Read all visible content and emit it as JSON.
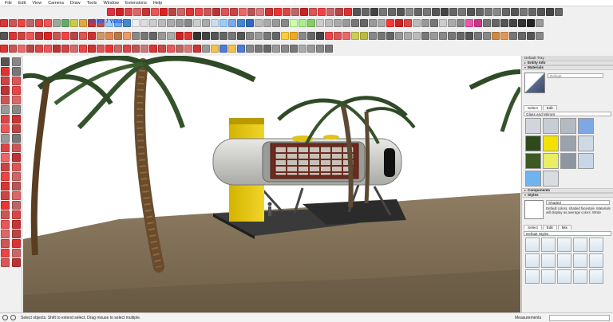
{
  "menubar": [
    "File",
    "Edit",
    "View",
    "Camera",
    "Draw",
    "Tools",
    "Window",
    "Extensions",
    "Help"
  ],
  "toolbar": {
    "skinx_label": "SkinX / YBub",
    "row1_colors": [
      "#d34",
      "#c22",
      "#d44",
      "#d66",
      "#c33",
      "#e55",
      "#d22",
      "#b44",
      "#c66",
      "#d33",
      "#e44",
      "#c55",
      "#b33",
      "#d55",
      "#c44",
      "#e66",
      "#b55",
      "#d77",
      "#c33",
      "#e33",
      "#d44",
      "#b66",
      "#c22",
      "#d55",
      "#e44",
      "#c66",
      "#b44",
      "#d33",
      "#555",
      "#666",
      "#444",
      "#777",
      "#666",
      "#555",
      "#888",
      "#666",
      "#777",
      "#555",
      "#444",
      "#666",
      "#777",
      "#555",
      "#666",
      "#777",
      "#888",
      "#666",
      "#555",
      "#777",
      "#666",
      "#555",
      "#444",
      "#666"
    ],
    "row2_colors": [
      "#d33",
      "#c55",
      "#e44",
      "#b66",
      "#d44",
      "#e55",
      "#9a9",
      "#6a6",
      "#cc4",
      "#da4",
      "#c33",
      "#b55",
      "#9cf",
      "#6af",
      "#48c",
      "#eee",
      "#ddd",
      "#ccc",
      "#bbb",
      "#aaa",
      "#999",
      "#888",
      "#ccc",
      "#aaa",
      "#cde",
      "#9cf",
      "#7ae",
      "#48c",
      "#36b",
      "#bbb",
      "#aaa",
      "#999",
      "#888",
      "#cfa",
      "#ae8",
      "#8c6",
      "#ccc",
      "#bbb",
      "#aaa",
      "#999",
      "#777",
      "#666",
      "#999",
      "#aaa",
      "#f33",
      "#c22",
      "#d44",
      "#bbb",
      "#999",
      "#777",
      "#ccc",
      "#aaa",
      "#888",
      "#e5a",
      "#c38",
      "#777",
      "#666",
      "#555",
      "#444",
      "#333",
      "#222",
      "#999"
    ],
    "row3_colors": [
      "#555",
      "#d33",
      "#c44",
      "#e55",
      "#b33",
      "#d22",
      "#c55",
      "#e44",
      "#b44",
      "#d55",
      "#c33",
      "#c96",
      "#d85",
      "#b74",
      "#e96",
      "#888",
      "#777",
      "#666",
      "#999",
      "#aaa",
      "#c22",
      "#d33",
      "#333",
      "#444",
      "#555",
      "#666",
      "#777",
      "#555",
      "#888",
      "#999",
      "#777",
      "#666",
      "#fc3",
      "#ea2",
      "#888",
      "#666",
      "#444",
      "#e44",
      "#d55",
      "#e66",
      "#cc5",
      "#bb4",
      "#888",
      "#777",
      "#666",
      "#999",
      "#aaa",
      "#bbb",
      "#777",
      "#999",
      "#888",
      "#777",
      "#666",
      "#555",
      "#777",
      "#888",
      "#c84",
      "#d95",
      "#777",
      "#666",
      "#555",
      "#888"
    ],
    "row4_colors": [
      "#d33",
      "#c55",
      "#e66",
      "#b44",
      "#d44",
      "#e55",
      "#b33",
      "#c44",
      "#d66",
      "#e44",
      "#c33",
      "#d55",
      "#e33",
      "#c66",
      "#d44",
      "#b55",
      "#c77",
      "#d33",
      "#c44",
      "#e55",
      "#b66",
      "#d77",
      "#c33",
      "#999",
      "#f2c14e",
      "#4b7bd8",
      "#f2c14e",
      "#4b7bd8",
      "#888",
      "#777",
      "#666",
      "#999",
      "#888",
      "#777",
      "#aaa",
      "#999",
      "#888",
      "#777"
    ],
    "left_colors": [
      "#555",
      "#888",
      "#d33",
      "#777",
      "#c44",
      "#d55",
      "#b33",
      "#e44",
      "#c55",
      "#d66",
      "#999",
      "#888",
      "#d44",
      "#c33",
      "#e55",
      "#b44",
      "#999",
      "#777",
      "#d44",
      "#c55",
      "#e66",
      "#b33",
      "#c44",
      "#d55",
      "#e44",
      "#c66",
      "#d33",
      "#b55",
      "#c44",
      "#d66",
      "#e33",
      "#b66",
      "#c55",
      "#d44",
      "#e55",
      "#c33",
      "#d66",
      "#b44",
      "#c55",
      "#d33",
      "#e44",
      "#c66",
      "#d55",
      "#b33"
    ]
  },
  "tray": {
    "title": "Default Tray",
    "entity_info": "Entity Info",
    "materials": {
      "header": "Materials",
      "name": "Default",
      "tabs": [
        "Select",
        "Edit"
      ],
      "library": "Glass and Mirrors",
      "swatches": [
        "#d2d6dc",
        "#c7cdd4",
        "#b3bac4",
        "#7ea7e6",
        "#2e4a1c",
        "#f5e100",
        "#9aa3ab",
        "#cfd9e6",
        "#3e5a22",
        "#e9ee63",
        "#8e97a1",
        "#c9d6ea",
        "#6fb3ef",
        "#d9dde2"
      ]
    },
    "components_header": "Components",
    "styles": {
      "header": "Styles",
      "name": "Shaded",
      "description": "Default colors, shaded facestyle. Materials will display as average colors. White",
      "tabs": [
        "Select",
        "Edit",
        "Mix"
      ],
      "library": "Default Styles"
    }
  },
  "status": {
    "hint": "Select objects. Shift to extend select. Drag mouse to select multiple.",
    "measurements_label": "Measurements"
  }
}
